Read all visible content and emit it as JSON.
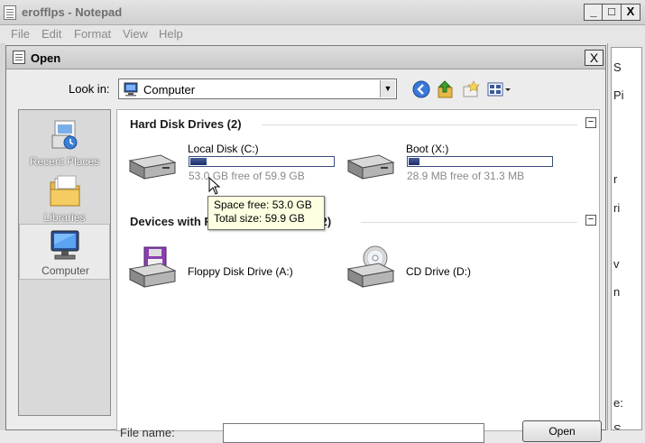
{
  "notepad": {
    "title": "erofflps - Notepad",
    "menu": [
      "File",
      "Edit",
      "Format",
      "View",
      "Help"
    ],
    "minimize": "_",
    "maximize": "□",
    "close": "X",
    "text_fragments": [
      "S",
      "Pi",
      "r",
      "ri",
      "v",
      "n",
      "e:",
      "S"
    ]
  },
  "dialog": {
    "title": "Open",
    "close": "X",
    "look_in_label": "Look in:",
    "look_in_value": "Computer",
    "places": [
      {
        "label": "Recent Places",
        "icon": "recent-places-icon"
      },
      {
        "label": "Libraries",
        "icon": "libraries-icon"
      },
      {
        "label": "Computer",
        "icon": "computer-icon",
        "selected": true
      }
    ],
    "groups": [
      {
        "header": "Hard Disk Drives (2)",
        "collapse": "−",
        "items": [
          {
            "name": "Local Disk (C:)",
            "free_text": "53.0 GB free of 59.9 GB",
            "used_fraction": 0.115,
            "icon": "hard-drive-icon"
          },
          {
            "name": "Boot (X:)",
            "free_text": "28.9 MB free of 31.3 MB",
            "used_fraction": 0.077,
            "icon": "hard-drive-icon"
          }
        ]
      },
      {
        "header": "Devices with Removable Storage (2)",
        "collapse": "−",
        "items": [
          {
            "name": "Floppy Disk Drive (A:)",
            "icon": "floppy-drive-icon"
          },
          {
            "name": "CD Drive (D:)",
            "icon": "cd-drive-icon"
          }
        ]
      }
    ],
    "tooltip": {
      "line1": "Space free: 53.0 GB",
      "line2": "Total size: 59.9 GB"
    },
    "bottom": {
      "file_name_label": "File name:",
      "open_button": "Open"
    }
  },
  "colors": {
    "bar_fill": "#1b2e6a",
    "tooltip_bg": "#ffffe1",
    "dialog_bg": "#ececec"
  }
}
